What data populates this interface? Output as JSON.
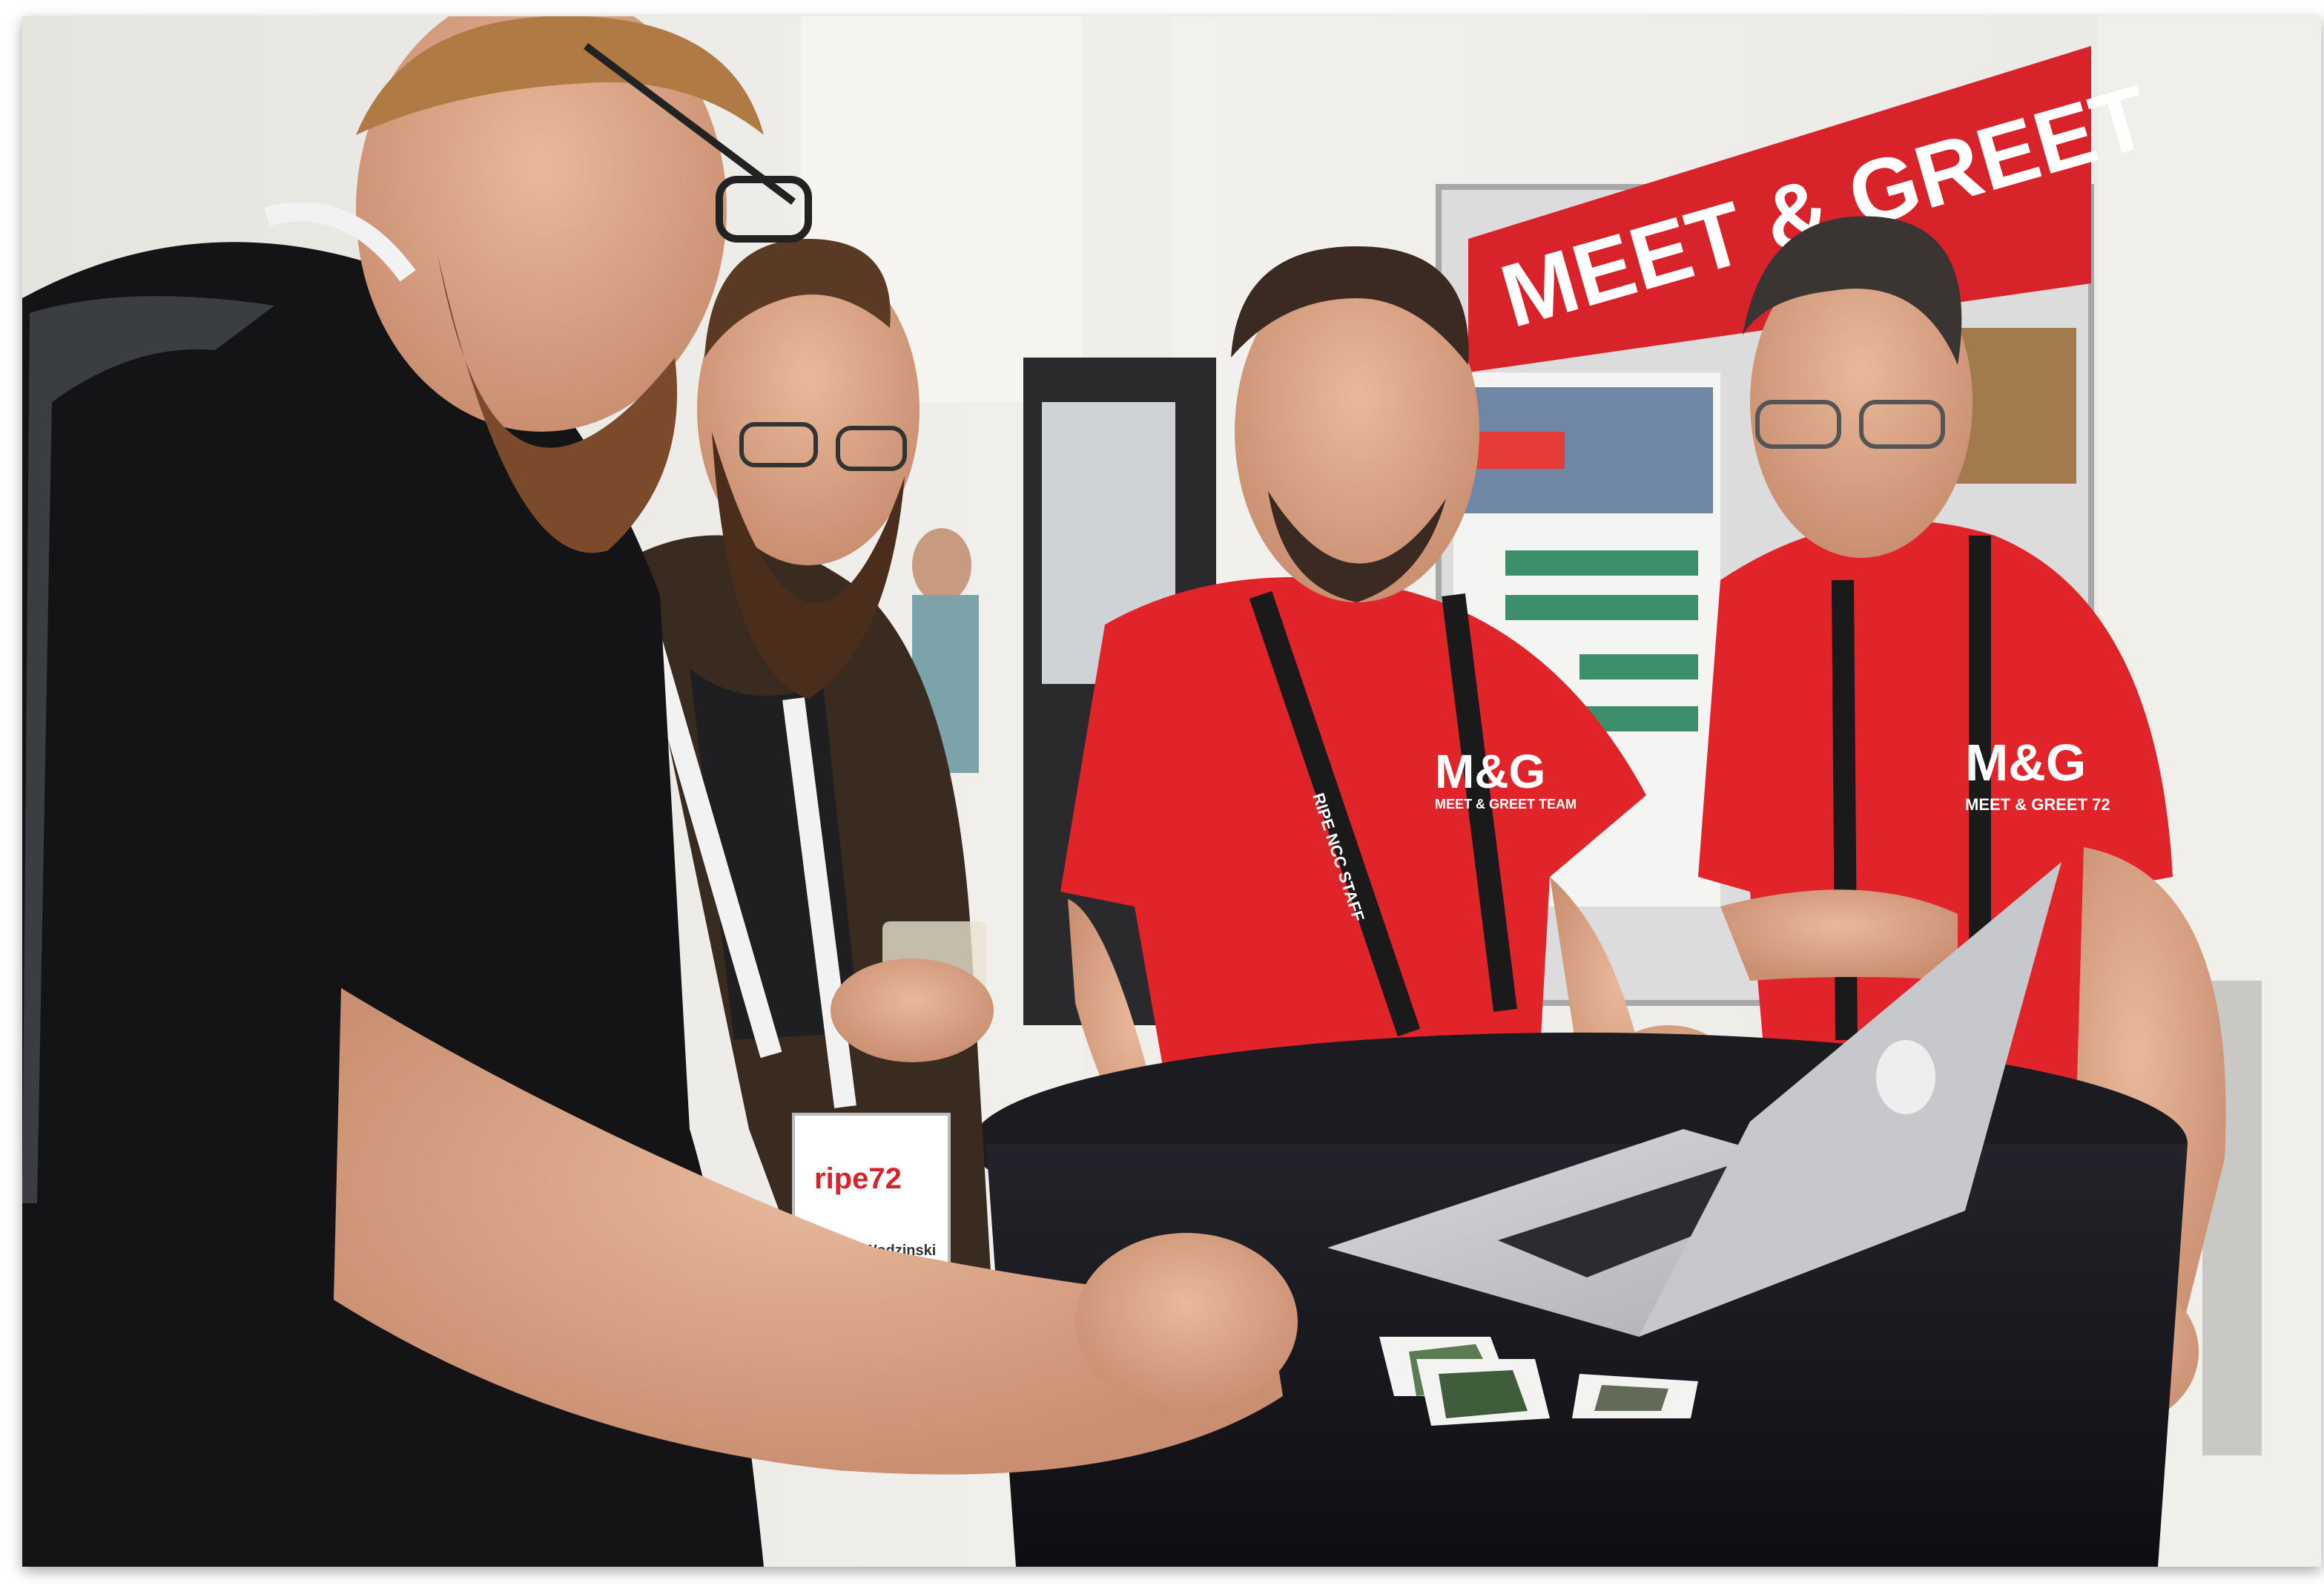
{
  "photo": {
    "description_labels": {
      "banner_text": "MEET & GREET",
      "shirt_logo_left": "M&G",
      "shirt_sub_left": "MEET & GREET TEAM",
      "shirt_logo_right": "M&G",
      "shirt_sub_right": "MEET & GREET 72",
      "lanyard_text": "RIPE NCC STAFF",
      "badge_event": "ripe72",
      "badge_name": "Michal Wodzinski"
    }
  },
  "colors": {
    "banner_red": "#d9232b",
    "shirt_red": "#e0242a",
    "table_black": "#16161a",
    "floor_light": "#eceae4"
  }
}
